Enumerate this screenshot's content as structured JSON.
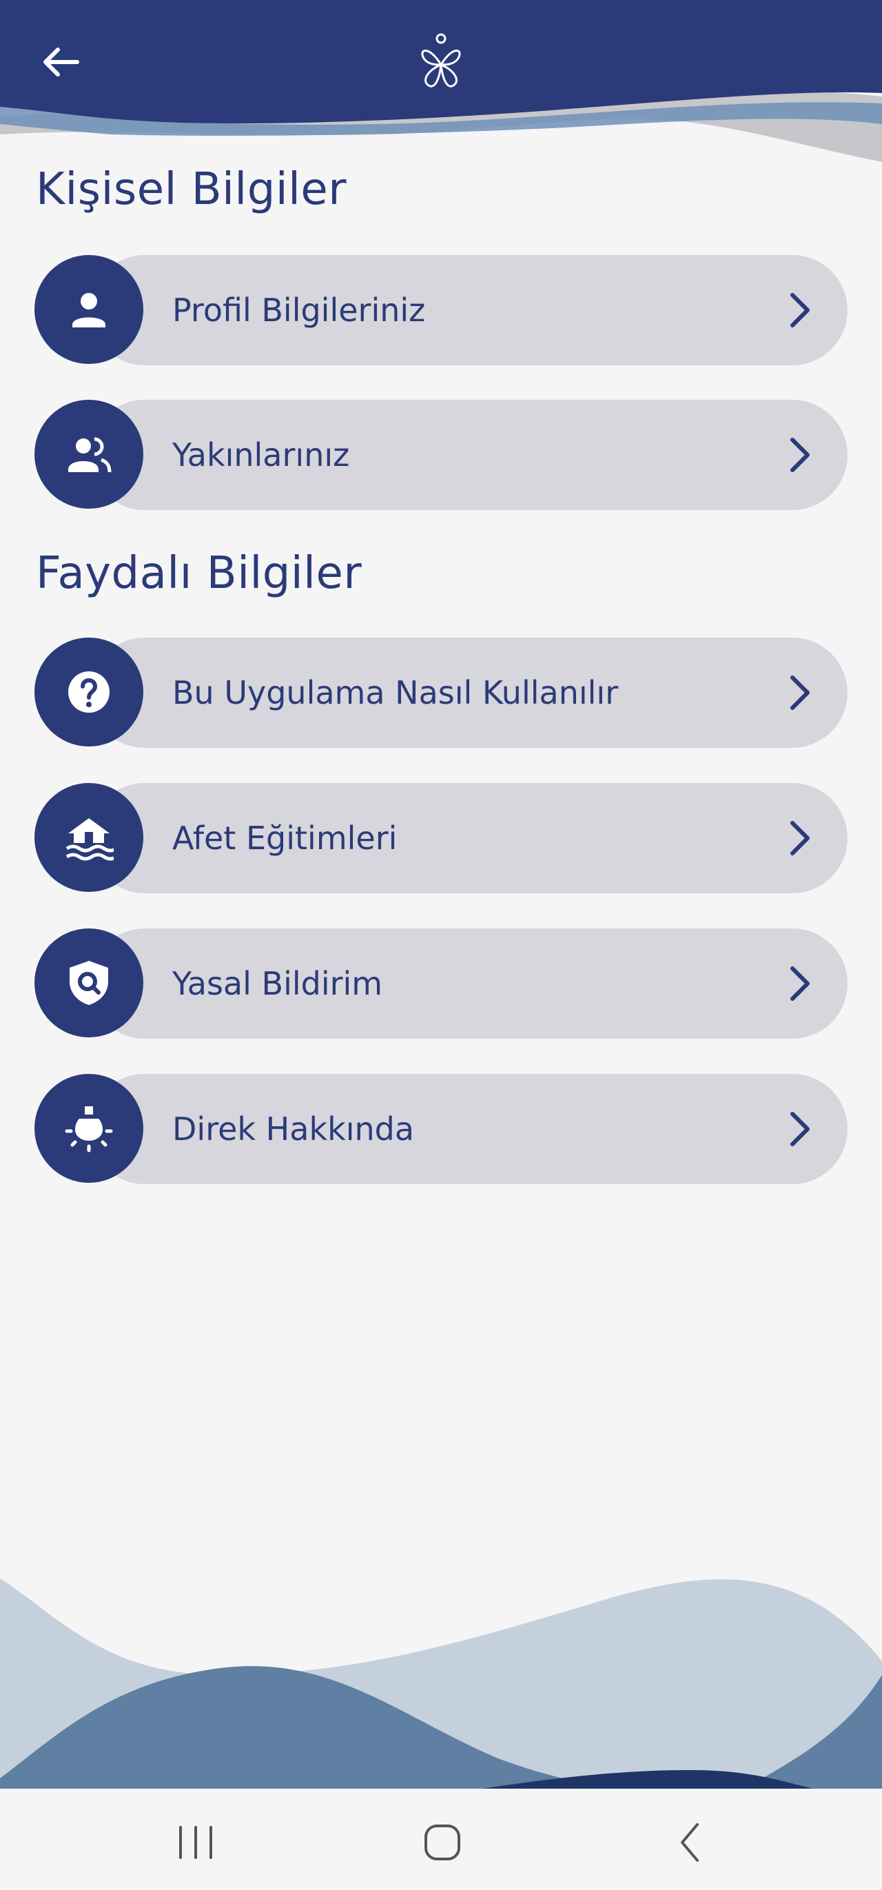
{
  "colors": {
    "primary": "#2b3a78",
    "pill": "#d6d6dc",
    "background": "#f5f5f6"
  },
  "header": {
    "back_icon": "arrow-left-icon",
    "logo_icon": "app-logo-icon"
  },
  "sections": [
    {
      "title": "Kişisel Bilgiler",
      "items": [
        {
          "label": "Profil Bilgileriniz",
          "icon": "person-icon"
        },
        {
          "label": "Yakınlarınız",
          "icon": "people-icon"
        }
      ]
    },
    {
      "title": "Faydalı Bilgiler",
      "items": [
        {
          "label": "Bu Uygulama Nasıl Kullanılır",
          "icon": "help-icon"
        },
        {
          "label": "Afet Eğitimleri",
          "icon": "flood-house-icon"
        },
        {
          "label": "Yasal Bildirim",
          "icon": "shield-search-icon"
        },
        {
          "label": "Direk Hakkında",
          "icon": "lightbulb-icon"
        }
      ]
    }
  ],
  "navbar": {
    "recent_icon": "recent-apps-icon",
    "home_icon": "home-icon",
    "back_icon": "nav-back-icon"
  }
}
